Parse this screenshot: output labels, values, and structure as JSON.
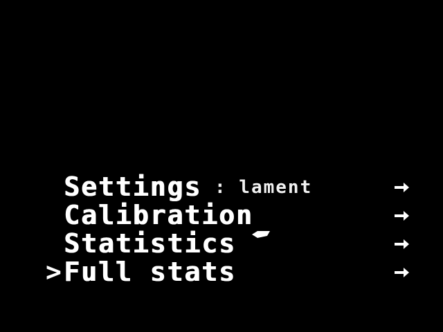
{
  "screen": {
    "background": "#000000",
    "foreground": "#ffffff"
  },
  "menu": {
    "cursor_symbol": ">",
    "selected_index": 3,
    "items": [
      {
        "label": "Settings",
        "sub_value": ": lament",
        "arrow_icon": "arrow-right-icon"
      },
      {
        "label": "Calibration",
        "arrow_icon": "arrow-right-icon"
      },
      {
        "label": "Statistics",
        "arrow_icon": "arrow-right-icon"
      },
      {
        "label": "Full stats",
        "arrow_icon": "arrow-right-icon"
      }
    ]
  }
}
